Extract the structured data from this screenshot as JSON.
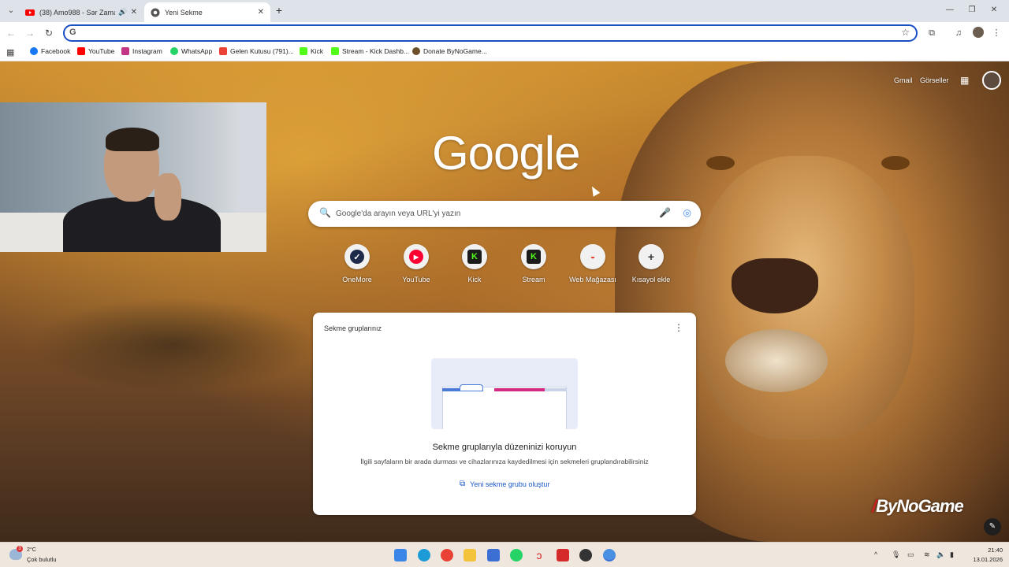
{
  "tabs": [
    {
      "label": "(38) Amo988 - Sər Zamanın",
      "icon": "youtube-icon"
    },
    {
      "label": "Yeni Sekme",
      "icon": "chrome-icon"
    }
  ],
  "toolbar": {
    "omnibox_value": "",
    "omnibox_placeholder": ""
  },
  "bookmarks": [
    {
      "label": "Facebook",
      "icon": "facebook-icon",
      "color": "#1877f2"
    },
    {
      "label": "YouTube",
      "icon": "youtube-icon",
      "color": "#ff0000"
    },
    {
      "label": "Instagram",
      "icon": "instagram-icon",
      "color": "#c13584"
    },
    {
      "label": "WhatsApp",
      "icon": "whatsapp-icon",
      "color": "#25d366"
    },
    {
      "label": "Gelen Kutusu (791)...",
      "icon": "gmail-icon",
      "color": "#ea4335"
    },
    {
      "label": "Kick",
      "icon": "kick-icon",
      "color": "#53fc18"
    },
    {
      "label": "Stream - Kick Dashb...",
      "icon": "kick-icon",
      "color": "#53fc18"
    },
    {
      "label": "Donate ByNoGame...",
      "icon": "donate-icon",
      "color": "#6b4f2a"
    }
  ],
  "ntp": {
    "links": {
      "gmail": "Gmail",
      "images": "Görseller"
    },
    "logo": "Google",
    "search_placeholder": "Google'da arayın veya URL'yi yazın",
    "shortcuts": [
      {
        "label": "OneMore",
        "icon": "onemore-icon",
        "color": "#1e2a4a",
        "glyph": "✓"
      },
      {
        "label": "YouTube",
        "icon": "youtube-icon",
        "color": "#ff0033",
        "glyph": "▶"
      },
      {
        "label": "Kick",
        "icon": "kick-icon",
        "color": "#1b1b1b",
        "glyph": "K"
      },
      {
        "label": "Stream",
        "icon": "kick-icon",
        "color": "#1b1b1b",
        "glyph": "K"
      },
      {
        "label": "Web Mağazası",
        "icon": "web-store-icon",
        "color": "#f1f1f1",
        "glyph": "◒"
      },
      {
        "label": "Kısayol ekle",
        "icon": "add-icon",
        "color": "#f1f1f1",
        "glyph": "+"
      }
    ],
    "card": {
      "title": "Sekme gruplarınız",
      "heading": "Sekme gruplarıyla düzeninizi koruyun",
      "subtitle": "İlgili sayfaların bir arada durması ve cihazlarınıza kaydedilmesi için sekmeleri gruplandırabilirsiniz",
      "action": "Yeni sekme grubu oluştur"
    },
    "watermark": "ByNoGame"
  },
  "taskbar": {
    "weather_badge": "3",
    "weather_temp": "2°C",
    "weather_desc": "Çok bulutlu",
    "time": "21:40",
    "date": "13.01.2026"
  }
}
